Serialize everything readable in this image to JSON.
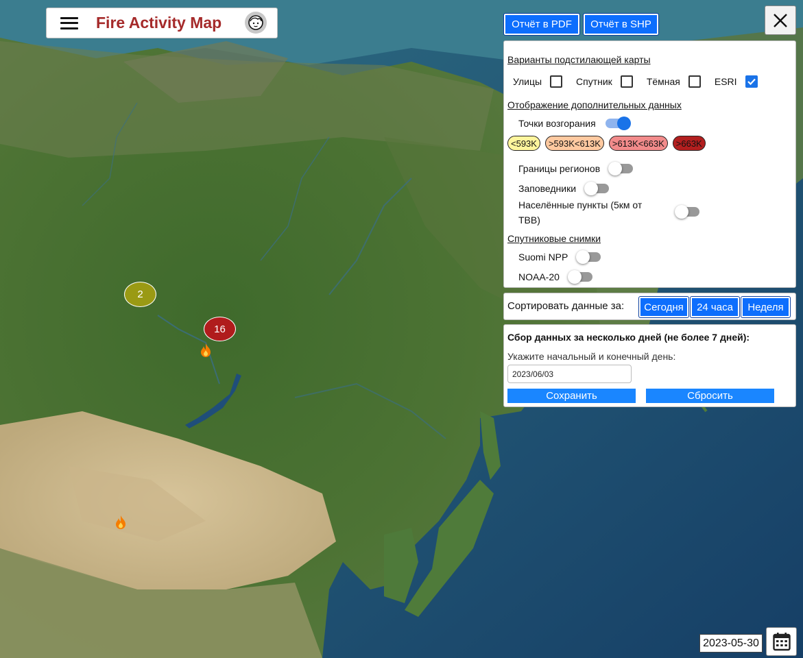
{
  "header": {
    "title": "Fire Activity Map"
  },
  "toolbar": {
    "pdf_label": "Отчёт в PDF",
    "shp_label": "Отчёт в SHP"
  },
  "layers": {
    "basemap_title": "Варианты подстилающей карты",
    "basemaps": [
      {
        "label": "Улицы",
        "checked": false
      },
      {
        "label": "Спутник",
        "checked": false
      },
      {
        "label": "Тёмная",
        "checked": false
      },
      {
        "label": "ESRI",
        "checked": true
      }
    ],
    "extra_title": "Отображение дополнительных данных",
    "hotspots_label": "Точки возгорания",
    "hotspots_on": true,
    "legend": [
      {
        "label": "<593K",
        "color": "#fff59d"
      },
      {
        "label": ">593K<613K",
        "color": "#ffc9a0"
      },
      {
        "label": ">613K<663K",
        "color": "#f28b8b"
      },
      {
        "label": ">663K",
        "color": "#b21f1f"
      }
    ],
    "regions_label": "Границы регионов",
    "reserves_label": "Заповедники",
    "settlements_label_line1": "Населённые пункты (5км от",
    "settlements_label_line2": "ТВВ)",
    "satellite_title": "Спутниковые снимки",
    "suomi_label": "Suomi NPP",
    "noaa_label": "NOAA-20"
  },
  "sort": {
    "label": "Сортировать данные за:",
    "today": "Сегодня",
    "day": "24 часа",
    "week": "Неделя"
  },
  "range": {
    "title": "Сбор данных за несколько дней (не более 7 дней):",
    "hint": "Укажите начальный и конечный день:",
    "date_value": "2023/06/03",
    "save_label": "Сохранить",
    "reset_label": "Сбросить"
  },
  "map": {
    "clusters": [
      {
        "count": "2",
        "color": "#9a9a14"
      },
      {
        "count": "16",
        "color": "#b01c1c"
      }
    ],
    "current_date": "2023-05-30"
  }
}
